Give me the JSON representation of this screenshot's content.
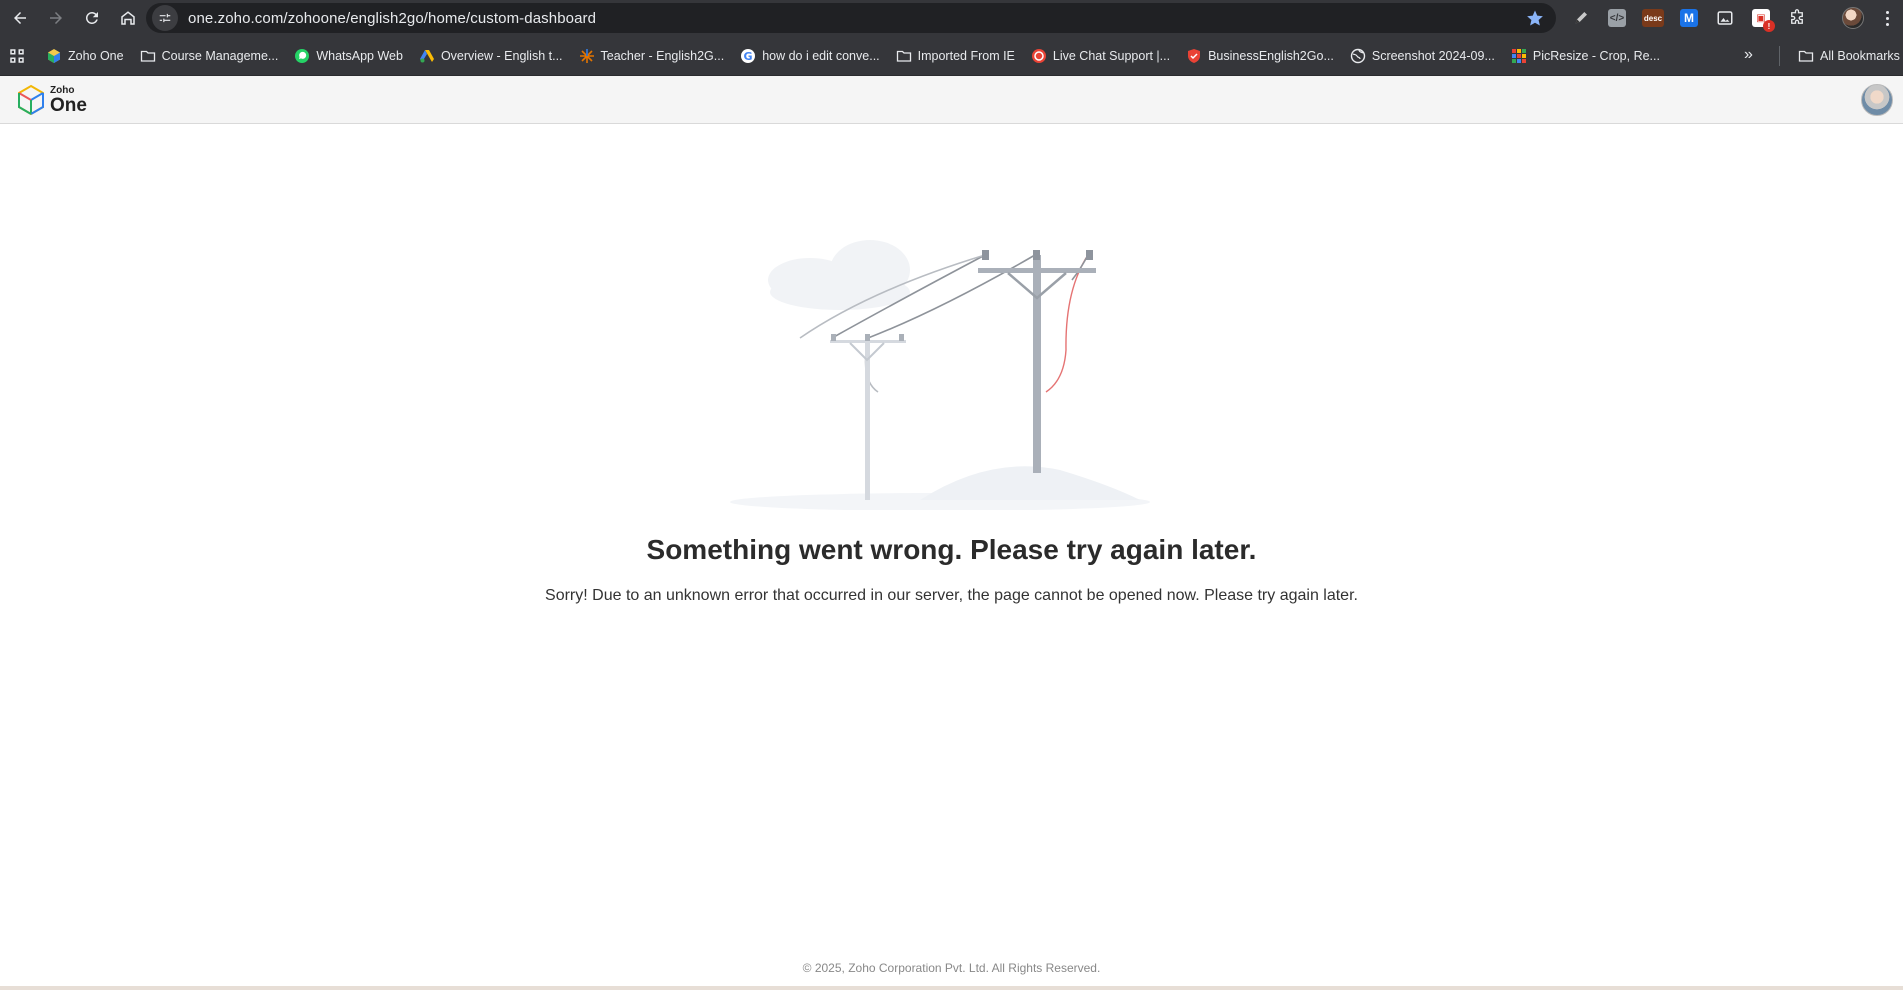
{
  "browser": {
    "url": "one.zoho.com/zohoone/english2go/home/custom-dashboard",
    "extensions": [
      "pen-icon",
      "code-icon",
      "desc-extension-icon",
      "m-extension-icon",
      "image-icon",
      "calendar-extension-icon",
      "puzzle-icon"
    ],
    "desc_label": "desc",
    "m_label": "M",
    "badge": "!"
  },
  "bookmarks": {
    "items": [
      {
        "label": "Zoho One",
        "icon": "zoho-icon"
      },
      {
        "label": "Course Manageme...",
        "icon": "folder-icon"
      },
      {
        "label": "WhatsApp Web",
        "icon": "whatsapp-icon"
      },
      {
        "label": "Overview - English t...",
        "icon": "google-ads-icon"
      },
      {
        "label": "Teacher - English2G...",
        "icon": "star-burst-icon"
      },
      {
        "label": "how do i edit conve...",
        "icon": "google-icon"
      },
      {
        "label": "Imported From IE",
        "icon": "folder-icon"
      },
      {
        "label": "Live Chat Support |...",
        "icon": "chat-icon"
      },
      {
        "label": "BusinessEnglish2Go...",
        "icon": "shield-icon"
      },
      {
        "label": "Screenshot 2024-09...",
        "icon": "globe-icon"
      },
      {
        "label": "PicResize - Crop, Re...",
        "icon": "picresize-icon"
      }
    ],
    "more": "»",
    "all_bookmarks": "All Bookmarks"
  },
  "app": {
    "logo_small": "Zoho",
    "logo_big": "One"
  },
  "error": {
    "title": "Something went wrong. Please try again later.",
    "message": "Sorry! Due to an unknown error that occurred in our server, the page cannot be opened now. Please try again later."
  },
  "footer": {
    "copyright": "© 2025, Zoho Corporation Pvt. Ltd. All Rights Reserved."
  },
  "colors": {
    "chrome_bg": "#35363a",
    "omnibox_bg": "#202124",
    "header_bg": "#f5f5f5",
    "title": "#2b2b2b",
    "wire_red": "#e57373"
  }
}
